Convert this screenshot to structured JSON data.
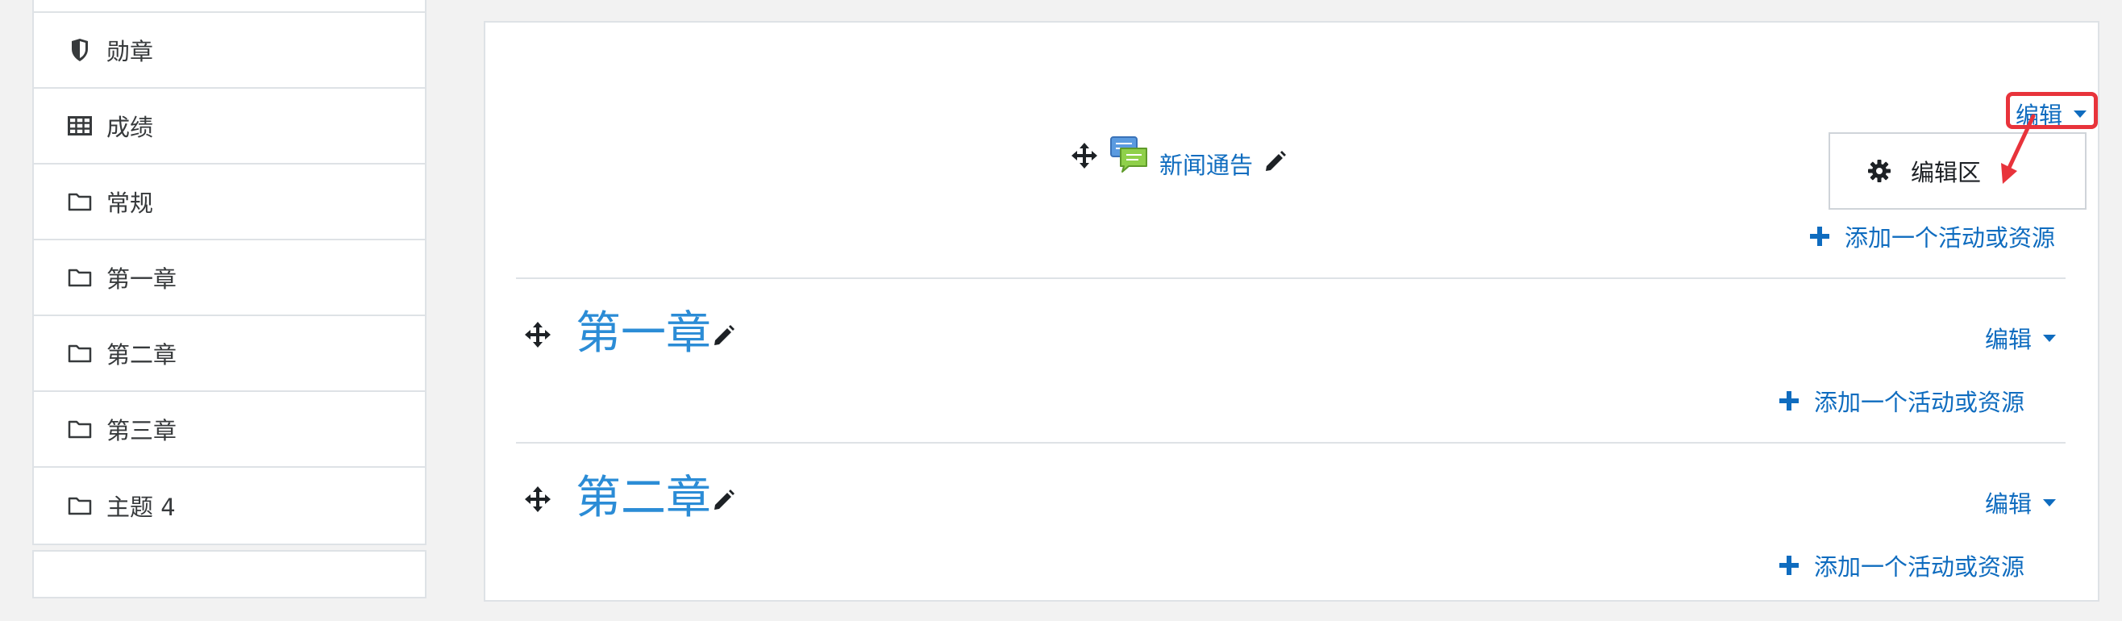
{
  "sidebar": {
    "items": [
      {
        "label": "勋章",
        "icon": "shield-icon"
      },
      {
        "label": "成绩",
        "icon": "table-icon"
      },
      {
        "label": "常规",
        "icon": "folder-icon"
      },
      {
        "label": "第一章",
        "icon": "folder-icon"
      },
      {
        "label": "第二章",
        "icon": "folder-icon"
      },
      {
        "label": "第三章",
        "icon": "folder-icon"
      },
      {
        "label": "主题 4",
        "icon": "folder-icon"
      }
    ]
  },
  "course": {
    "general_section": {
      "activity_label": "新闻通告",
      "activity_icon": "forum-icon",
      "edit_label": "编辑",
      "dropdown_item_label": "编辑区",
      "add_activity_label": "添加一个活动或资源"
    },
    "sections": [
      {
        "title": "第一章",
        "edit_label": "编辑",
        "add_activity_label": "添加一个活动或资源"
      },
      {
        "title": "第二章",
        "edit_label": "编辑",
        "add_activity_label": "添加一个活动或资源"
      }
    ]
  },
  "colors": {
    "link": "#0f6cbf",
    "section_title": "#2b8cd6",
    "annotation": "#e8333b",
    "border": "#dee2e6"
  }
}
